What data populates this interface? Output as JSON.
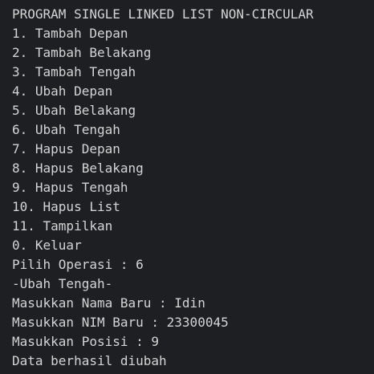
{
  "terminal": {
    "lines": [
      "PROGRAM SINGLE LINKED LIST NON-CIRCULAR",
      "1. Tambah Depan",
      "2. Tambah Belakang",
      "3. Tambah Tengah",
      "4. Ubah Depan",
      "5. Ubah Belakang",
      "6. Ubah Tengah",
      "7. Hapus Depan",
      "8. Hapus Belakang",
      "9. Hapus Tengah",
      "10. Hapus List",
      "11. Tampilkan",
      "0. Keluar",
      "Pilih Operasi : 6",
      "-Ubah Tengah-",
      "Masukkan Nama Baru : Idin",
      "Masukkan NIM Baru : 23300045",
      "Masukkan Posisi : 9",
      "Data berhasil diubah"
    ],
    "colors": {
      "background": "#1e1f22",
      "text": "#d4d4d4"
    }
  }
}
